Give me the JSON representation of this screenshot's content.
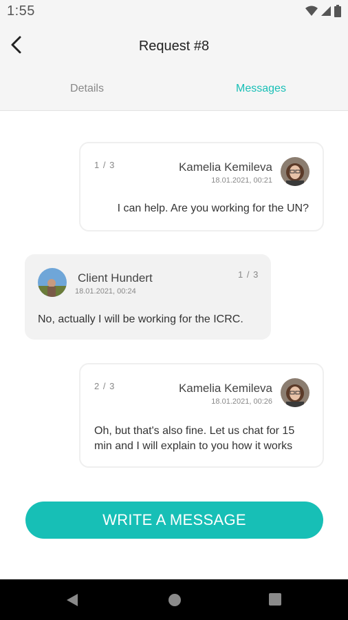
{
  "status": {
    "time": "1:55"
  },
  "header": {
    "title": "Request #8"
  },
  "tabs": [
    {
      "label": "Details"
    },
    {
      "label": "Messages"
    }
  ],
  "messages": [
    {
      "direction": "out",
      "counter": "1 / 3",
      "sender": "Kamelia Kemileva",
      "date": "18.01.2021, 00:21",
      "text": "I can help. Are you working for the UN?"
    },
    {
      "direction": "in",
      "counter": "1 / 3",
      "sender": "Client  Hundert",
      "date": "18.01.2021, 00:24",
      "text": "No, actually I will be working for the ICRC."
    },
    {
      "direction": "out",
      "counter": "2 / 3",
      "sender": "Kamelia Kemileva",
      "date": "18.01.2021, 00:26",
      "text": "Oh, but that's also fine. Let us chat for 15 min and I will explain to you how it works"
    }
  ],
  "actions": {
    "write_label": "WRITE A MESSAGE"
  },
  "colors": {
    "accent": "#17bfb6",
    "header_bg": "#f5f5f5",
    "incoming_bg": "#f2f2f2"
  }
}
